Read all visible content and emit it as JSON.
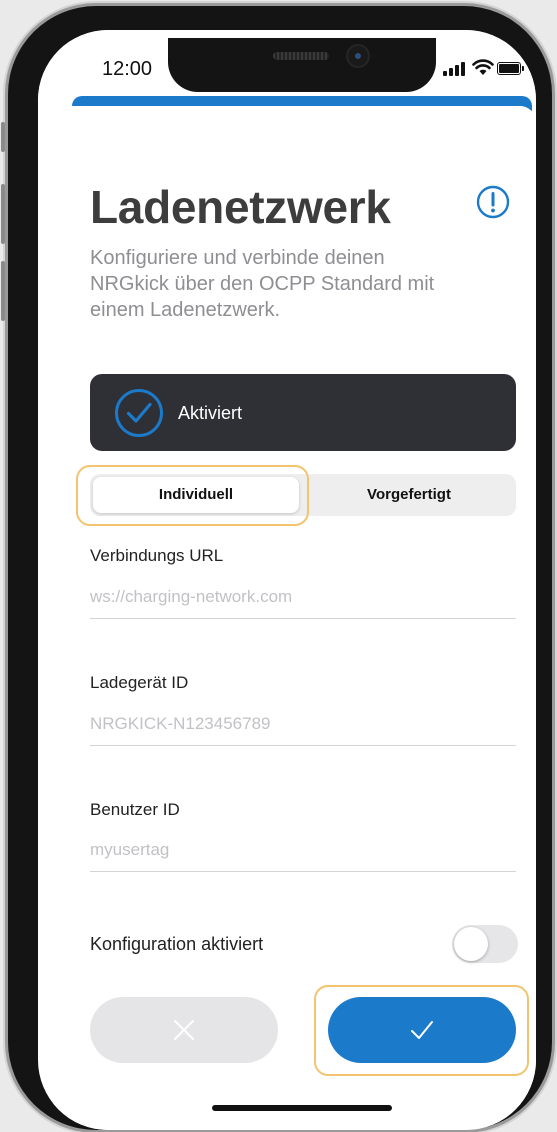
{
  "status_bar": {
    "time": "12:00",
    "icons": [
      "cellular-signal-icon",
      "wifi-icon",
      "battery-icon"
    ]
  },
  "header": {
    "title": "Ladenetzwerk",
    "info_icon": "info-circle-icon"
  },
  "description": "Konfiguriere und verbinde deinen NRGkick über den OCPP Standard mit einem Ladenetzwerk.",
  "activation_card": {
    "label": "Aktiviert",
    "icon": "check-circle-icon",
    "checked": true
  },
  "mode_selector": {
    "options": [
      "Individuell",
      "Vorgefertigt"
    ],
    "selected": "Individuell"
  },
  "form": {
    "url": {
      "label": "Verbindungs URL",
      "placeholder": "ws://charging-network.com"
    },
    "charger_id": {
      "label": "Ladegerät ID",
      "placeholder": "NRGKICK-N123456789"
    },
    "user_id": {
      "label": "Benutzer ID",
      "placeholder": "myusertag"
    }
  },
  "config_toggle": {
    "label": "Konfiguration aktiviert",
    "on": false
  },
  "actions": {
    "cancel_icon": "close-icon",
    "confirm_icon": "checkmark-icon"
  },
  "colors": {
    "accent": "#1b7ac9",
    "card_dark": "#2f2f36",
    "highlight": "#f2c470",
    "title": "#3d3d3d",
    "secondary_text": "#8e8e93"
  }
}
